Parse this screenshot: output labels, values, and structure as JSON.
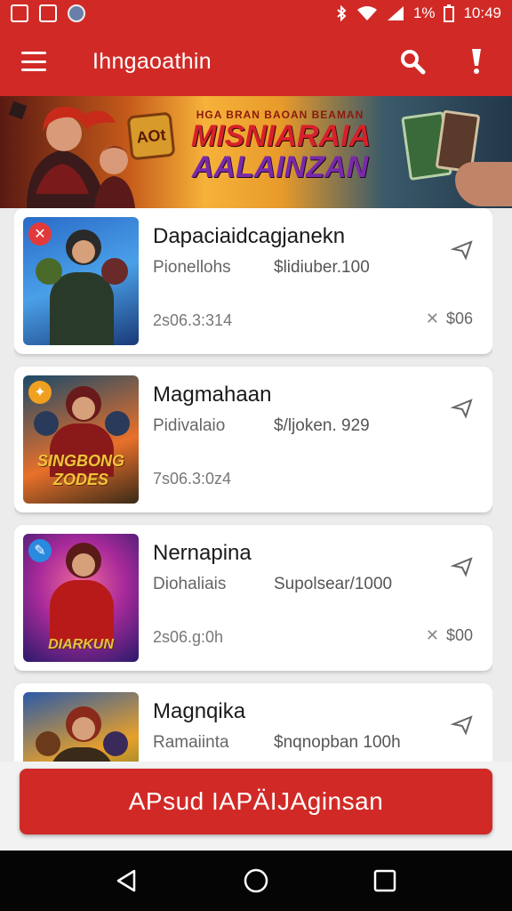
{
  "status_bar": {
    "battery": "1%",
    "time": "10:49"
  },
  "app_bar": {
    "title": "Ihngaoathin",
    "menu_icon": "menu-icon",
    "search_icon": "search-icon",
    "alert_icon": "alert-icon"
  },
  "banner": {
    "logo_text": "AOt",
    "small_text": "HGA BRAN BAOAN BEAMAN",
    "line1": "MISNIARAIA",
    "line2": "AALAINZAN"
  },
  "items": [
    {
      "title": "Dapaciaidcagjanekn",
      "category": "Pionellohs",
      "detail": "$lidiuber.100",
      "date": "2s06.3:314",
      "price": "$06",
      "badge": "✕",
      "thumb_text": ""
    },
    {
      "title": "Magmahaan",
      "category": "Pidivalaio",
      "detail": "$/ljoken. 929",
      "date": "7s06.3:0z4",
      "price": "",
      "badge": "",
      "thumb_text": "SINGBONG ZODES"
    },
    {
      "title": "Nernapina",
      "category": "Diohaliais",
      "detail": "Supolsear/1000",
      "date": "2s06.g:0h",
      "price": "$00",
      "badge": "✎",
      "thumb_text": "DIARKUN"
    },
    {
      "title": "Magnqika",
      "category": "Ramaiinta",
      "detail": "$nqnopban 100h",
      "date": "",
      "price": "",
      "badge": "",
      "thumb_text": ""
    }
  ],
  "cta": {
    "label": "APsud IAPÄIJAginsan"
  },
  "colors": {
    "primary": "#d12a26",
    "background": "#ececec",
    "nav": "#050505"
  }
}
